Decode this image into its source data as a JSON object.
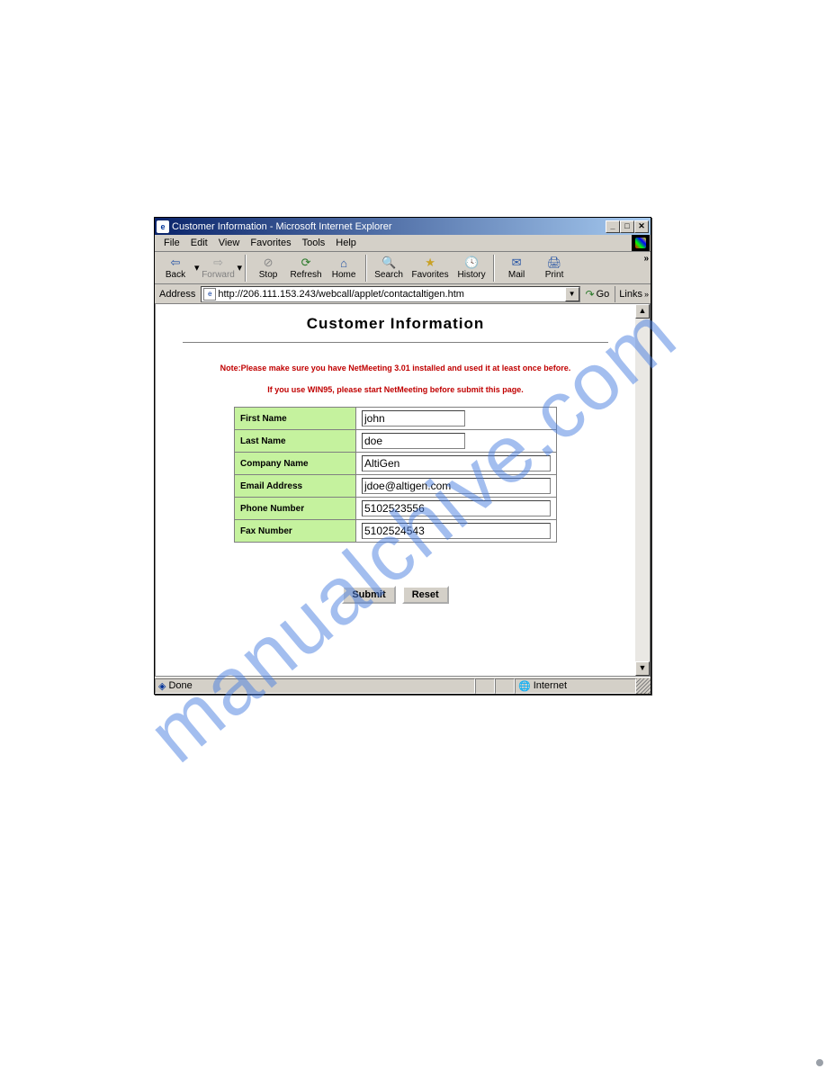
{
  "watermark": "manualchive.com",
  "window": {
    "title": "Customer Information - Microsoft Internet Explorer"
  },
  "window_controls": {
    "minimize": "_",
    "maximize": "□",
    "close": "✕"
  },
  "menubar": {
    "items": [
      "File",
      "Edit",
      "View",
      "Favorites",
      "Tools",
      "Help"
    ]
  },
  "toolbar": {
    "back": "Back",
    "forward": "Forward",
    "stop": "Stop",
    "refresh": "Refresh",
    "home": "Home",
    "search": "Search",
    "favorites": "Favorites",
    "history": "History",
    "mail": "Mail",
    "print": "Print"
  },
  "addressbar": {
    "label": "Address",
    "url": "http://206.111.153.243/webcall/applet/contactaltigen.htm",
    "go": "Go",
    "links": "Links"
  },
  "page": {
    "heading": "Customer Information",
    "note1": "Note:Please make sure you have NetMeeting 3.01 installed and used it at least once before.",
    "note2": "If you use WIN95, please start NetMeeting before submit this page.",
    "fields": {
      "first_name_label": "First Name",
      "first_name_value": "john",
      "last_name_label": "Last Name",
      "last_name_value": "doe",
      "company_label": "Company Name",
      "company_value": "AltiGen",
      "email_label": "Email Address",
      "email_value": "jdoe@altigen.com",
      "phone_label": "Phone Number",
      "phone_value": "5102523556",
      "fax_label": "Fax Number",
      "fax_value": "5102524543"
    },
    "submit": "Submit",
    "reset": "Reset"
  },
  "statusbar": {
    "status": "Done",
    "zone": "Internet"
  }
}
